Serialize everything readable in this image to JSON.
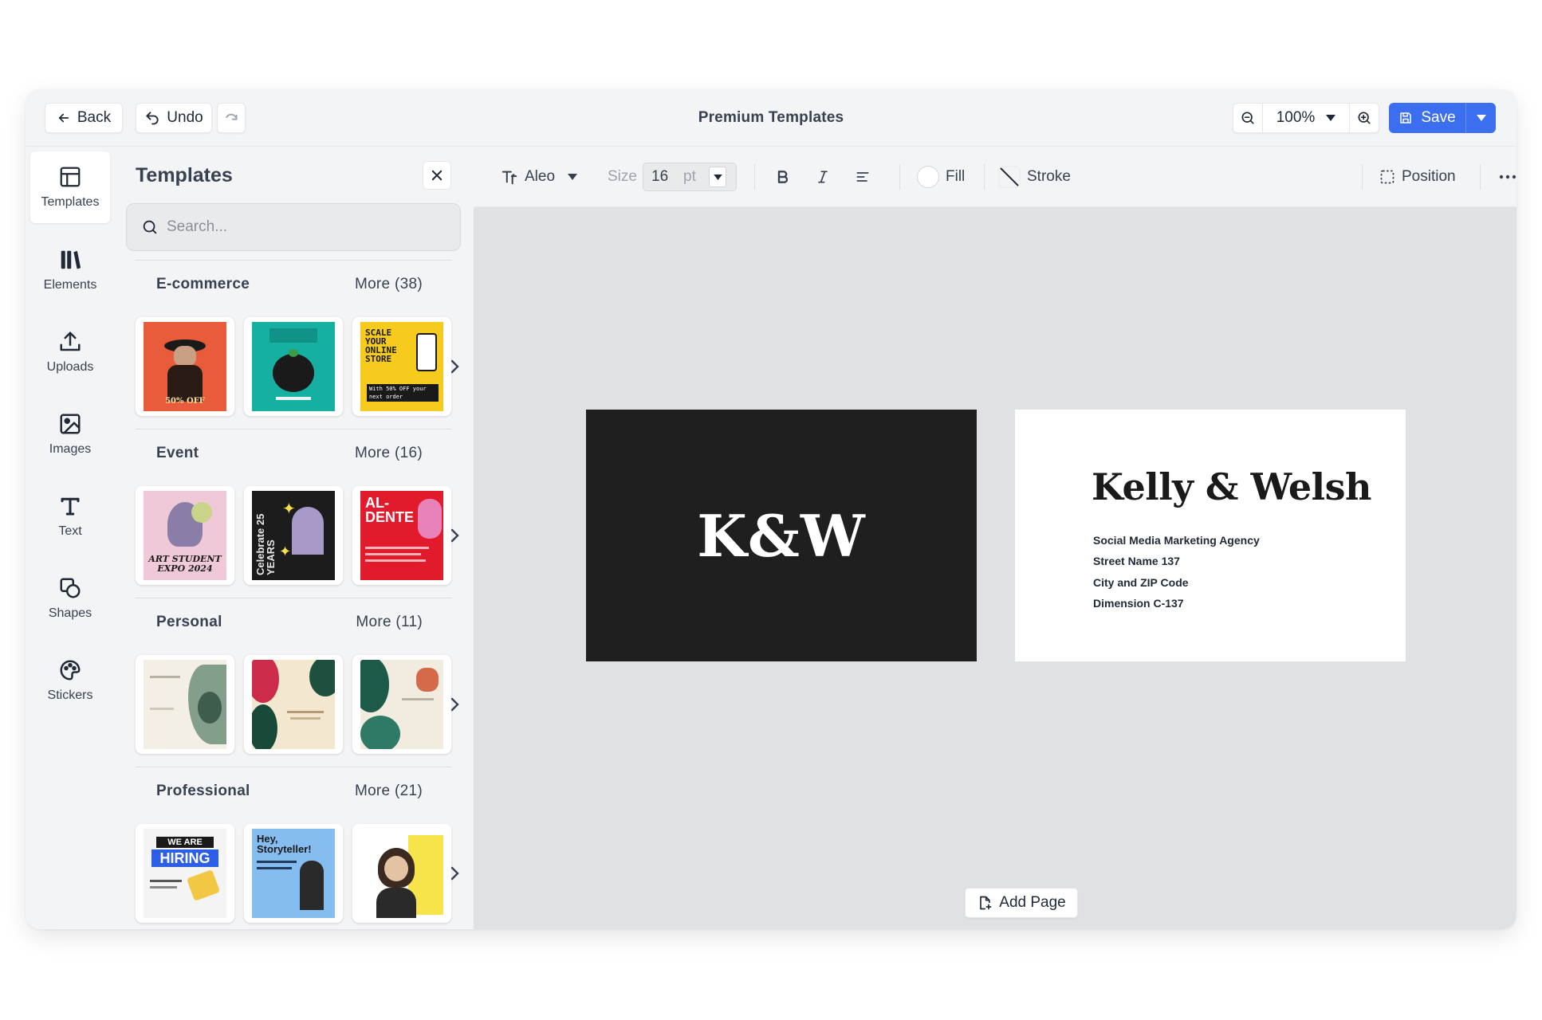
{
  "header": {
    "back_label": "Back",
    "undo_label": "Undo",
    "title": "Premium Templates",
    "zoom_value": "100%",
    "save_label": "Save"
  },
  "rail": {
    "items": [
      {
        "label": "Templates",
        "icon": "layout-template-icon",
        "active": true
      },
      {
        "label": "Elements",
        "icon": "library-icon",
        "active": false
      },
      {
        "label": "Uploads",
        "icon": "upload-icon",
        "active": false
      },
      {
        "label": "Images",
        "icon": "image-icon",
        "active": false
      },
      {
        "label": "Text",
        "icon": "text-icon",
        "active": false
      },
      {
        "label": "Shapes",
        "icon": "shapes-icon",
        "active": false
      },
      {
        "label": "Stickers",
        "icon": "sticker-icon",
        "active": false
      }
    ]
  },
  "panel": {
    "title": "Templates",
    "search_placeholder": "Search...",
    "sections": [
      {
        "name": "E-commerce",
        "more": "More (38)"
      },
      {
        "name": "Event",
        "more": "More (16)"
      },
      {
        "name": "Personal",
        "more": "More (11)"
      },
      {
        "name": "Professional",
        "more": "More (21)"
      }
    ],
    "thumb_text": {
      "ecom1": "50% OFF",
      "ecom3_a": "SCALE YOUR ONLINE STORE",
      "ecom3_b": "With 50% OFF your next order",
      "event1": "ART STUDENT EXPO 2024",
      "event2": "Celebrate 25 YEARS",
      "event3": "AL-DENTE",
      "pro1_a": "WE ARE",
      "pro1_b": "HIRING",
      "pro2": "Hey, Storyteller!"
    }
  },
  "toolbar": {
    "font_name": "Aleo",
    "size_label": "Size",
    "size_value": "16",
    "size_unit": "pt",
    "fill_label": "Fill",
    "stroke_label": "Stroke",
    "position_label": "Position"
  },
  "canvas": {
    "dark_card_logo": "K&W",
    "light_card_brand": "Kelly & Welsh",
    "light_card_lines": [
      "Social Media Marketing Agency",
      "Street Name 137",
      "City and ZIP Code",
      "Dimension C-137"
    ],
    "add_page_label": "Add Page"
  }
}
